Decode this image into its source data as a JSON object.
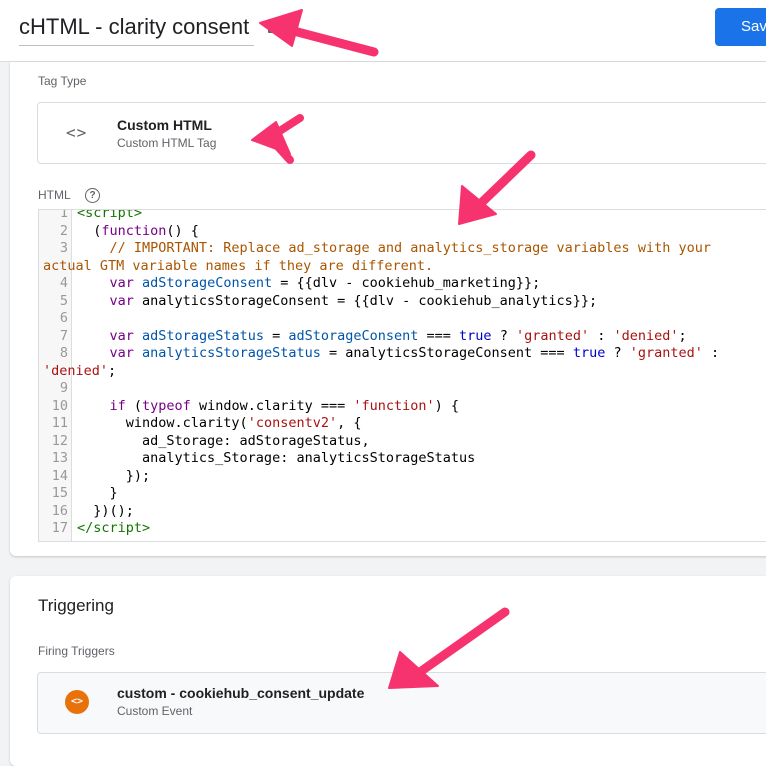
{
  "header": {
    "title": "cHTML - clarity consent",
    "save_label": "Sav"
  },
  "tag_config": {
    "tag_type_label": "Tag Type",
    "tag_type_name": "Custom HTML",
    "tag_type_sub": "Custom HTML Tag",
    "html_label": "HTML",
    "help_glyph": "?",
    "code_icon": "<>"
  },
  "code_lines": [
    {
      "n": "1",
      "html": "<span class=\"t\">&lt;script&gt;</span>"
    },
    {
      "n": "2",
      "html": "  (<span class=\"k\">function</span>() {"
    },
    {
      "n": "3",
      "html": "    <span class=\"c\">// IMPORTANT: Replace ad_storage and analytics_storage variables with your</span>"
    },
    {
      "n": "",
      "html": "<span class=\"c\">actual GTM variable names if they are different.</span>"
    },
    {
      "n": "4",
      "html": "    <span class=\"k\">var</span> <span class=\"v\">adStorageConsent</span> = {{dlv - cookiehub_marketing}};"
    },
    {
      "n": "5",
      "html": "    <span class=\"k\">var</span> analyticsStorageConsent = {{dlv - cookiehub_analytics}};"
    },
    {
      "n": "6",
      "html": ""
    },
    {
      "n": "7",
      "html": "    <span class=\"k\">var</span> <span class=\"v\">adStorageStatus</span> = <span class=\"v\">adStorageConsent</span> === <span class=\"a\">true</span> ? <span class=\"s\">'granted'</span> : <span class=\"s\">'denied'</span>;"
    },
    {
      "n": "8",
      "html": "    <span class=\"k\">var</span> <span class=\"v\">analyticsStorageStatus</span> = analyticsStorageConsent === <span class=\"a\">true</span> ? <span class=\"s\">'granted'</span> :"
    },
    {
      "n": "",
      "html": "<span class=\"s\">'denied'</span>;"
    },
    {
      "n": "9",
      "html": ""
    },
    {
      "n": "10",
      "html": "    <span class=\"k\">if</span> (<span class=\"k\">typeof</span> window.clarity === <span class=\"s\">'function'</span>) {"
    },
    {
      "n": "11",
      "html": "      window.clarity(<span class=\"s\">'consentv2'</span>, {"
    },
    {
      "n": "12",
      "html": "        ad_Storage: adStorageStatus,"
    },
    {
      "n": "13",
      "html": "        analytics_Storage: analyticsStorageStatus"
    },
    {
      "n": "14",
      "html": "      });"
    },
    {
      "n": "15",
      "html": "    }"
    },
    {
      "n": "16",
      "html": "  })();"
    },
    {
      "n": "17",
      "html": "<span class=\"t\">&lt;/script&gt;</span>"
    }
  ],
  "triggering": {
    "title": "Triggering",
    "firing_label": "Firing Triggers",
    "trigger_name": "custom - cookiehub_consent_update",
    "trigger_sub": "Custom Event",
    "trigger_icon": "<>"
  },
  "colors": {
    "accent": "#1a73e8",
    "annotation_arrow": "#f7336f",
    "trigger_icon": "#e8710a"
  }
}
